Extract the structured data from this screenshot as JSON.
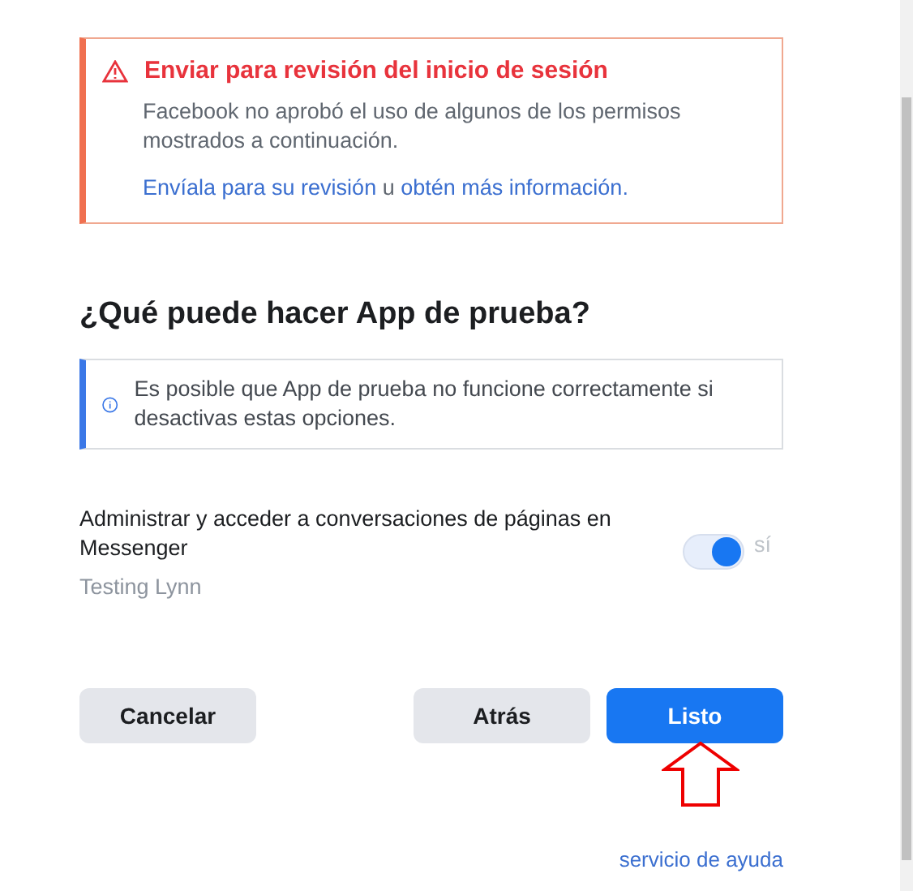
{
  "alert": {
    "title": "Enviar para revisión del inicio de sesión",
    "message": "Facebook no aprobó el uso de algunos de los permisos mostrados a continuación.",
    "link_1": "Envíala para su revisión",
    "joiner": "u",
    "link_2": "obtén más información."
  },
  "heading": "¿Qué puede hacer App de prueba?",
  "info": "Es posible que App de prueba no funcione correctamente si desactivas estas opciones.",
  "permissions": [
    {
      "label": "Administrar y acceder a conversaciones de páginas en Messenger",
      "account": "Testing Lynn",
      "on": true,
      "state_label": "sí"
    }
  ],
  "buttons": [
    {
      "label": "Cancelar",
      "kind": "secondary"
    },
    {
      "label": "Atrás",
      "kind": "secondary"
    },
    {
      "label": "Listo",
      "kind": "primary"
    }
  ],
  "help_link": "servicio de ayuda"
}
